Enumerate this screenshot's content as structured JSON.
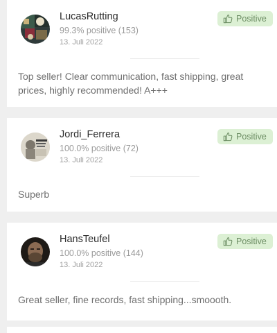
{
  "reviews": [
    {
      "username": "LucasRutting",
      "score": "99.3% positive (153)",
      "date": "13. Juli 2022",
      "rating": "Positive",
      "comment": "Top seller! Clear communication, fast shipping, great prices, highly recommended! A+++",
      "avatar_icon": "user-avatar-photo"
    },
    {
      "username": "Jordi_Ferrera",
      "score": "100.0% positive (72)",
      "date": "13. Juli 2022",
      "rating": "Positive",
      "comment": "Superb",
      "avatar_icon": "user-avatar-photo"
    },
    {
      "username": "HansTeufel",
      "score": "100.0% positive (144)",
      "date": "13. Juli 2022",
      "rating": "Positive",
      "comment": "Great seller, fine records, fast shipping...smoooth.",
      "avatar_icon": "user-avatar-photo"
    }
  ],
  "badge_icon": "thumbs-up-icon",
  "colors": {
    "badge_bg": "#dcf0d4",
    "badge_text": "#6d8e64",
    "page_bg": "#efefef",
    "card_bg": "#ffffff"
  }
}
